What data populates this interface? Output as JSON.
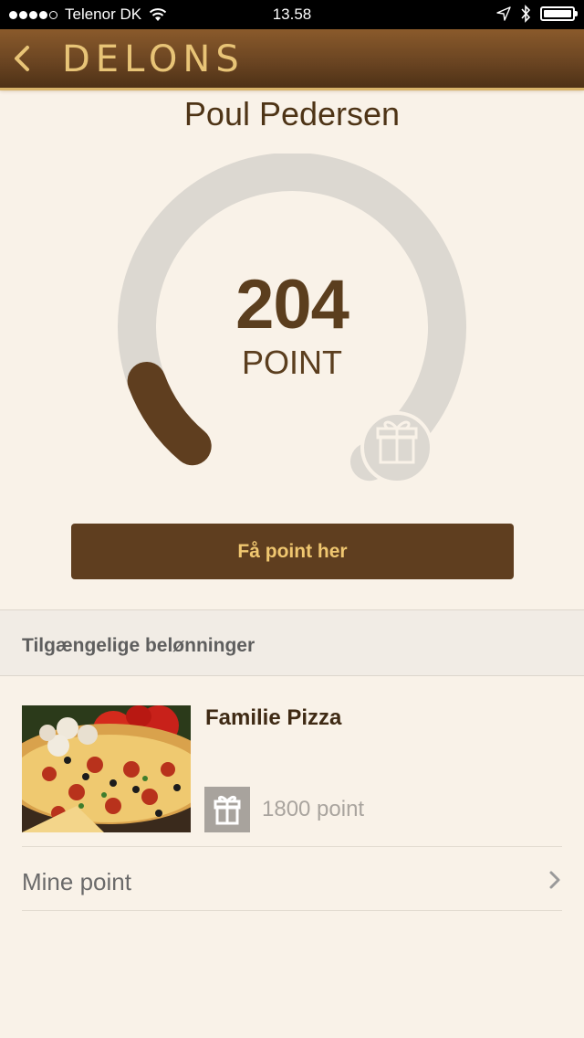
{
  "status_bar": {
    "carrier": "Telenor DK",
    "time": "13.58"
  },
  "nav": {
    "logo_text": "DELONS"
  },
  "profile": {
    "name": "Poul Pedersen"
  },
  "points": {
    "value": "204",
    "unit": "POINT",
    "progress_fraction": 0.11
  },
  "cta": {
    "label": "Få point her"
  },
  "rewards_section": {
    "title": "Tilgængelige belønninger",
    "items": [
      {
        "title": "Familie Pizza",
        "cost": "1800 point"
      }
    ]
  },
  "menu": {
    "mine_point_label": "Mine point"
  },
  "colors": {
    "brand_brown": "#5f3e1f",
    "gold": "#e8c477",
    "background": "#f9f2e8",
    "gauge_track": "#dcd8d1"
  }
}
